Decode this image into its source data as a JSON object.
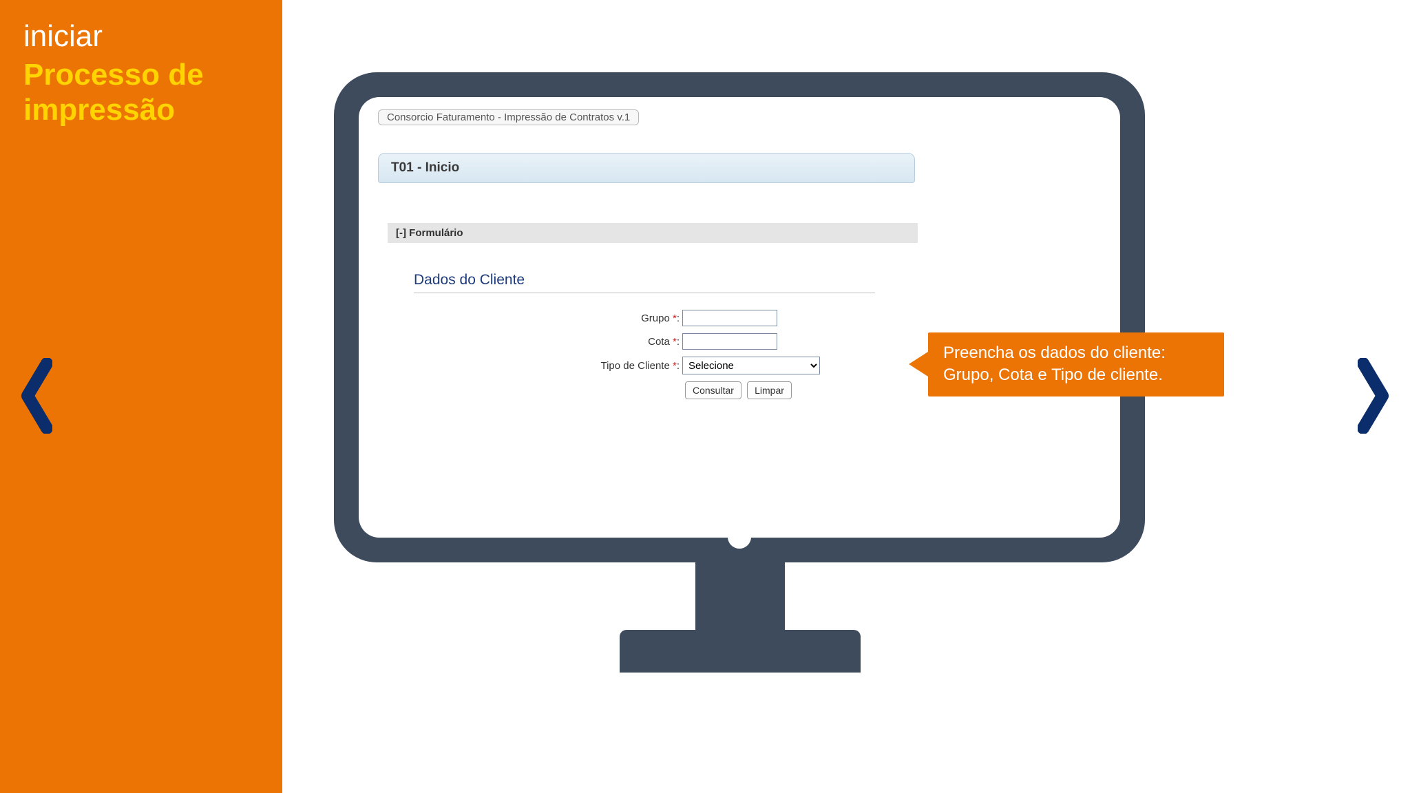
{
  "sidebar": {
    "line1": "iniciar",
    "line2": "Processo de impressão"
  },
  "screen": {
    "breadcrumb": "Consorcio Faturamento - Impressão de Contratos v.1",
    "tab_title": "T01 - Inicio",
    "section_header": "[-] Formulário",
    "form_title": "Dados do Cliente",
    "fields": {
      "grupo_label": "Grupo",
      "cota_label": "Cota",
      "tipo_label": "Tipo de Cliente",
      "required_mark": "*",
      "colon": ":"
    },
    "tipo_selected": "Selecione",
    "buttons": {
      "consultar": "Consultar",
      "limpar": "Limpar"
    }
  },
  "callout": {
    "line1": "Preencha os dados do cliente:",
    "line2": "Grupo, Cota e Tipo de cliente."
  }
}
